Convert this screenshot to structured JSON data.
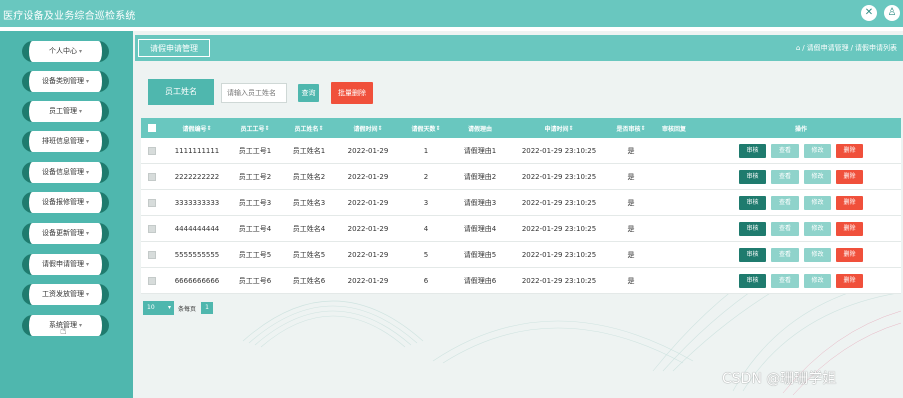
{
  "app": {
    "title": "医疗设备及业务综合巡检系统"
  },
  "header_icons": [
    "close-icon",
    "user-icon"
  ],
  "sidebar": {
    "items": [
      {
        "label": "个人中心"
      },
      {
        "label": "设备类别管理"
      },
      {
        "label": "员工管理"
      },
      {
        "label": "排班信息管理"
      },
      {
        "label": "设备信息管理"
      },
      {
        "label": "设备报修管理"
      },
      {
        "label": "设备更新管理"
      },
      {
        "label": "请假申请管理"
      },
      {
        "label": "工资发放管理"
      },
      {
        "label": "系统管理"
      }
    ]
  },
  "breadcrumb": {
    "tab_label": "请假申请管理",
    "home_icon": "home-icon",
    "crumbs": [
      "请假申请管理",
      "请假申请列表"
    ]
  },
  "search": {
    "label": "员工姓名",
    "placeholder": "请输入员工姓名",
    "query_label": "查询",
    "batch_delete_label": "批量删除"
  },
  "table": {
    "columns": [
      "请假编号",
      "员工工号",
      "员工姓名",
      "请假时间",
      "请假天数",
      "请假理由",
      "申请时间",
      "是否审核",
      "审核回复",
      "操作"
    ],
    "rows": [
      {
        "id": "1111111111",
        "emp_no": "员工工号1",
        "name": "员工姓名1",
        "date": "2022-01-29",
        "days": "1",
        "reason": "请假理由1",
        "apply_time": "2022-01-29 23:10:25",
        "reviewed": "是",
        "reply": ""
      },
      {
        "id": "2222222222",
        "emp_no": "员工工号2",
        "name": "员工姓名2",
        "date": "2022-01-29",
        "days": "2",
        "reason": "请假理由2",
        "apply_time": "2022-01-29 23:10:25",
        "reviewed": "是",
        "reply": ""
      },
      {
        "id": "3333333333",
        "emp_no": "员工工号3",
        "name": "员工姓名3",
        "date": "2022-01-29",
        "days": "3",
        "reason": "请假理由3",
        "apply_time": "2022-01-29 23:10:25",
        "reviewed": "是",
        "reply": ""
      },
      {
        "id": "4444444444",
        "emp_no": "员工工号4",
        "name": "员工姓名4",
        "date": "2022-01-29",
        "days": "4",
        "reason": "请假理由4",
        "apply_time": "2022-01-29 23:10:25",
        "reviewed": "是",
        "reply": ""
      },
      {
        "id": "5555555555",
        "emp_no": "员工工号5",
        "name": "员工姓名5",
        "date": "2022-01-29",
        "days": "5",
        "reason": "请假理由5",
        "apply_time": "2022-01-29 23:10:25",
        "reviewed": "是",
        "reply": ""
      },
      {
        "id": "6666666666",
        "emp_no": "员工工号6",
        "name": "员工姓名6",
        "date": "2022-01-29",
        "days": "6",
        "reason": "请假理由6",
        "apply_time": "2022-01-29 23:10:25",
        "reviewed": "是",
        "reply": ""
      }
    ],
    "row_actions": {
      "audit": "审核",
      "view": "查看",
      "edit": "修改",
      "delete": "删除"
    }
  },
  "pager": {
    "page_size": "10",
    "per_page_label": "条每页",
    "current_page": "1"
  },
  "watermark": "CSDN @珊珊学姐",
  "colors": {
    "primary": "#69c7bf",
    "sidebar": "#4fb7ae",
    "dark": "#1f7b6e",
    "danger": "#f0503b"
  }
}
